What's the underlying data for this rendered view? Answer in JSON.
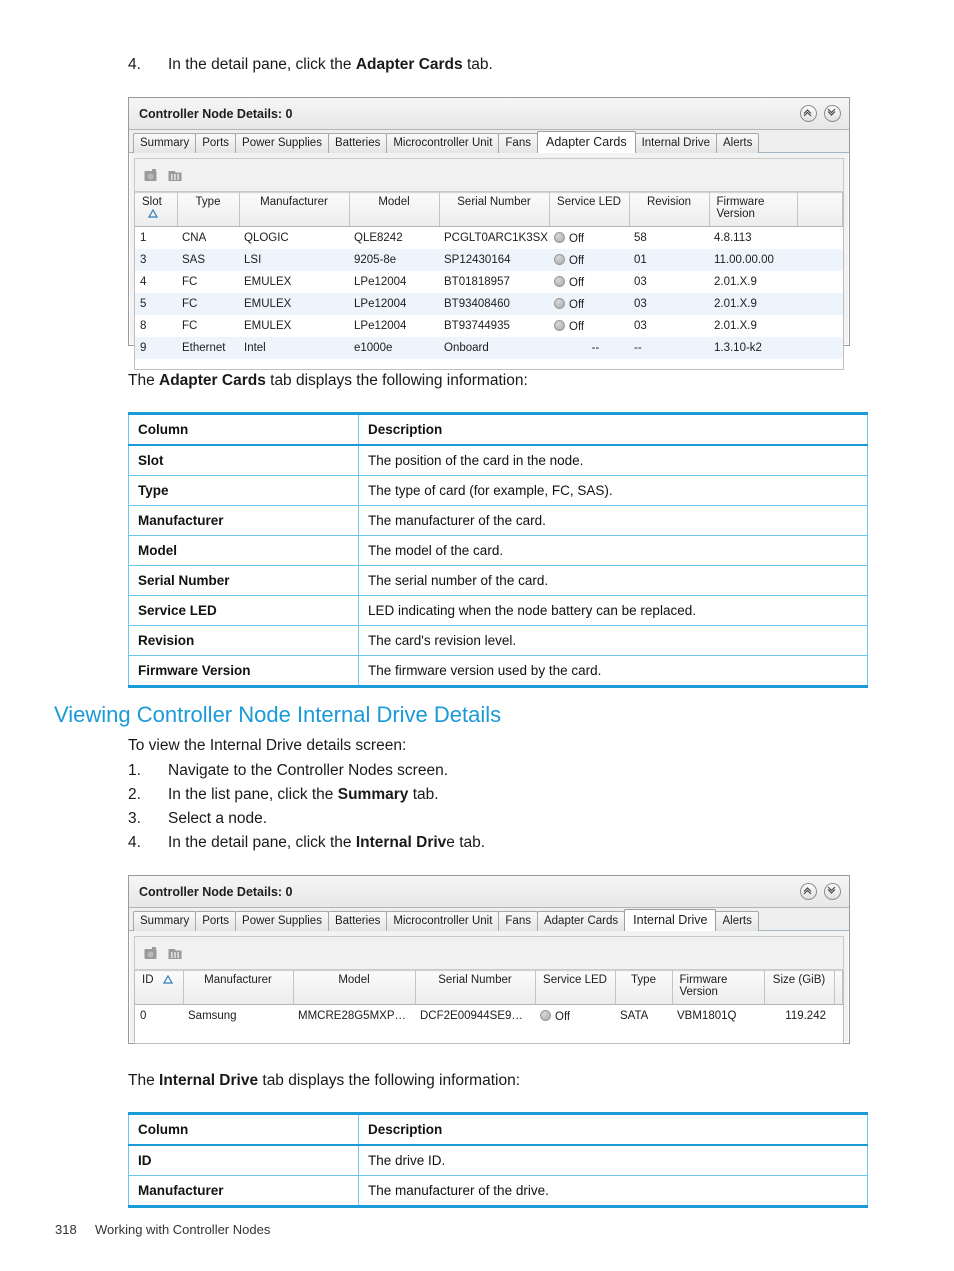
{
  "page": {
    "footer_number": "318",
    "footer_title": "Working with Controller Nodes"
  },
  "steps_top": {
    "step4_num": "4.",
    "step4_pre": "In the detail pane, click the ",
    "step4_bold": "Adapter Cards",
    "step4_post": " tab."
  },
  "adapter_intro": {
    "pre": "The ",
    "bold": "Adapter Cards",
    "post": "  tab displays the following information:"
  },
  "screenshot_adapter": {
    "title": "Controller Node Details: 0",
    "collapse_icon": "chevron-double-up-icon",
    "expand_icon": "chevron-double-down-icon",
    "tabs": [
      {
        "label": "Summary",
        "active": false
      },
      {
        "label": "Ports",
        "active": false
      },
      {
        "label": "Power Supplies",
        "active": false
      },
      {
        "label": "Batteries",
        "active": false
      },
      {
        "label": "Microcontroller Unit",
        "active": false
      },
      {
        "label": "Fans",
        "active": false
      },
      {
        "label": "Adapter Cards",
        "active": true
      },
      {
        "label": "Internal Drive",
        "active": false
      },
      {
        "label": "Alerts",
        "active": false
      }
    ],
    "toolbar_icons": [
      "export-image-icon",
      "export-table-icon"
    ],
    "columns": [
      "Slot",
      "Type",
      "Manufacturer",
      "Model",
      "Serial Number",
      "Service LED",
      "Revision",
      "Firmware\nVersion",
      ""
    ],
    "sort_column": "Slot",
    "sort_icon": "sort-ascending-triangle-icon",
    "rows": [
      {
        "slot": "1",
        "type": "CNA",
        "manufacturer": "QLOGIC",
        "model": "QLE8242",
        "serial": "PCGLT0ARC1K3SX",
        "led": "Off",
        "revision": "58",
        "firmware": "4.8.113"
      },
      {
        "slot": "3",
        "type": "SAS",
        "manufacturer": "LSI",
        "model": "9205-8e",
        "serial": "SP12430164",
        "led": "Off",
        "revision": "01",
        "firmware": "11.00.00.00"
      },
      {
        "slot": "4",
        "type": "FC",
        "manufacturer": "EMULEX",
        "model": "LPe12004",
        "serial": "BT01818957",
        "led": "Off",
        "revision": "03",
        "firmware": "2.01.X.9"
      },
      {
        "slot": "5",
        "type": "FC",
        "manufacturer": "EMULEX",
        "model": "LPe12004",
        "serial": "BT93408460",
        "led": "Off",
        "revision": "03",
        "firmware": "2.01.X.9"
      },
      {
        "slot": "8",
        "type": "FC",
        "manufacturer": "EMULEX",
        "model": "LPe12004",
        "serial": "BT93744935",
        "led": "Off",
        "revision": "03",
        "firmware": "2.01.X.9"
      },
      {
        "slot": "9",
        "type": "Ethernet",
        "manufacturer": "Intel",
        "model": "e1000e",
        "serial": "Onboard",
        "led": "--",
        "revision": "--",
        "firmware": "1.3.10-k2"
      }
    ]
  },
  "adapter_desc_table": {
    "headers": [
      "Column",
      "Description"
    ],
    "rows": [
      [
        "Slot",
        "The position of the card in the node."
      ],
      [
        "Type",
        "The type of card (for example, FC, SAS)."
      ],
      [
        "Manufacturer",
        "The manufacturer of the card."
      ],
      [
        "Model",
        "The model of the card."
      ],
      [
        "Serial Number",
        "The serial number of the card."
      ],
      [
        "Service LED",
        "LED indicating when the node battery can be replaced."
      ],
      [
        "Revision",
        "The card's revision level."
      ],
      [
        "Firmware Version",
        "The firmware version used by the card."
      ]
    ]
  },
  "section": {
    "heading": "Viewing Controller Node Internal Drive Details",
    "lead_in": "To view the Internal Drive details screen:",
    "steps": [
      {
        "num": "1.",
        "pre": "Navigate to the Controller Nodes screen.",
        "bold": "",
        "post": ""
      },
      {
        "num": "2.",
        "pre": "In the list pane, click the ",
        "bold": "Summary",
        "post": " tab."
      },
      {
        "num": "3.",
        "pre": "Select a node.",
        "bold": "",
        "post": ""
      },
      {
        "num": "4.",
        "pre": "In the detail pane, click the ",
        "bold": "Internal Driv",
        "post": "e tab."
      }
    ]
  },
  "screenshot_internal": {
    "title": "Controller Node Details: 0",
    "collapse_icon": "chevron-double-up-icon",
    "expand_icon": "chevron-double-down-icon",
    "tabs": [
      {
        "label": "Summary",
        "active": false
      },
      {
        "label": "Ports",
        "active": false
      },
      {
        "label": "Power Supplies",
        "active": false
      },
      {
        "label": "Batteries",
        "active": false
      },
      {
        "label": "Microcontroller Unit",
        "active": false
      },
      {
        "label": "Fans",
        "active": false
      },
      {
        "label": "Adapter Cards",
        "active": false
      },
      {
        "label": "Internal Drive",
        "active": true
      },
      {
        "label": "Alerts",
        "active": false
      }
    ],
    "toolbar_icons": [
      "export-image-icon",
      "export-table-icon"
    ],
    "columns": [
      "ID",
      "Manufacturer",
      "Model",
      "Serial Number",
      "Service LED",
      "Type",
      "Firmware\nVersion",
      "Size (GiB)",
      ""
    ],
    "sort_column": "ID",
    "sort_icon": "sort-ascending-triangle-icon",
    "rows": [
      {
        "id": "0",
        "manufacturer": "Samsung",
        "model": "MMCRE28G5MXP…",
        "serial": "DCF2E00944SE9…",
        "led": "Off",
        "type": "SATA",
        "firmware": "VBM1801Q",
        "size": "119.242"
      }
    ]
  },
  "internal_intro": {
    "pre": "The ",
    "bold": "Internal Drive",
    "post": "  tab displays the following information:"
  },
  "internal_desc_table": {
    "headers": [
      "Column",
      "Description"
    ],
    "rows": [
      [
        "ID",
        "The drive ID."
      ],
      [
        "Manufacturer",
        "The manufacturer of the drive."
      ]
    ]
  },
  "colors": {
    "heading_blue": "#1a9ad7",
    "table_border_blue": "#6fc6ec",
    "row_stripe": "#eef4fb"
  }
}
